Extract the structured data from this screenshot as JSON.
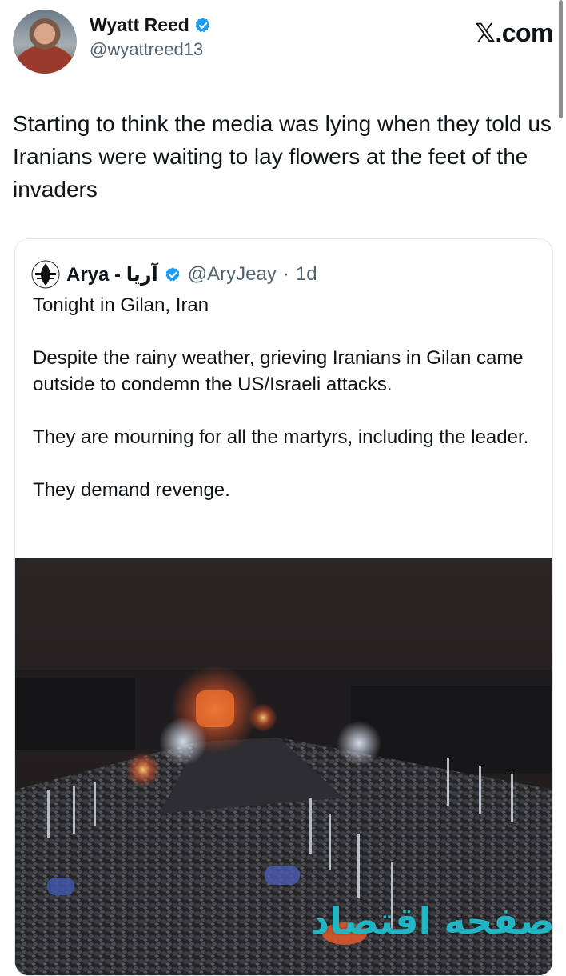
{
  "colors": {
    "verified_blue": "#1d9bf0",
    "text_primary": "#0f1419",
    "text_secondary": "#536471",
    "card_border": "#e1e8ed",
    "watermark": "#21b5c6"
  },
  "tweet": {
    "author_name": "Wyatt Reed",
    "author_handle": "@wyattreed13",
    "verified_icon": "verified-badge-icon",
    "text": "Starting to think the media was lying when they told us Iranians were waiting to lay flowers at the feet of the invaders"
  },
  "site_logo": "𝕏.com",
  "quoted": {
    "author_name": "Arya - آریا",
    "author_handle": "@AryJeay",
    "separator": "·",
    "time": "1d",
    "paragraphs": [
      "Tonight in Gilan, Iran",
      "Despite the rainy weather, grieving Iranians in Gilan came outside to condemn the US/Israeli attacks.",
      "They are mourning for all the martyrs, including the leader.",
      "They demand revenge."
    ]
  },
  "watermark_text": "صفحه اقتصاد"
}
